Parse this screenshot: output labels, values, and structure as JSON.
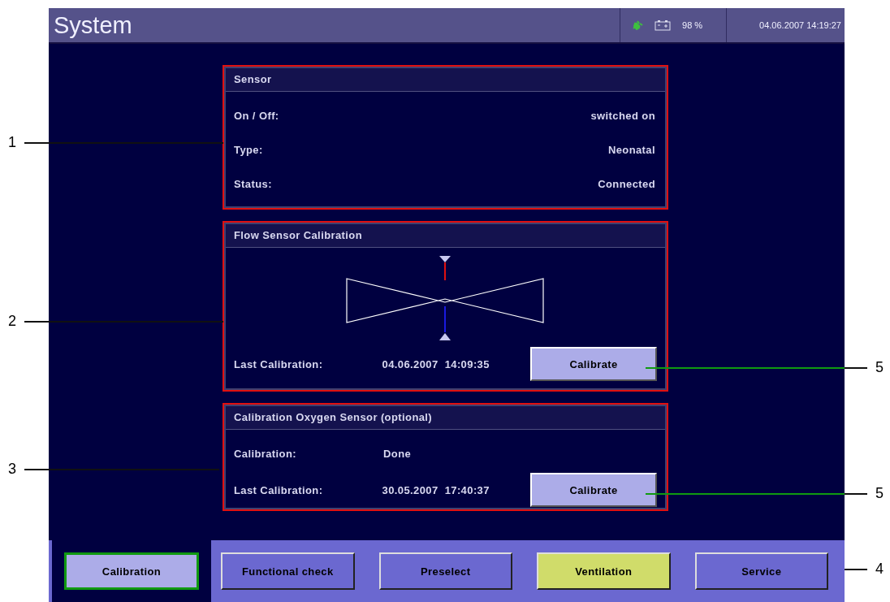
{
  "header": {
    "title": "System",
    "battery": "98 %",
    "datetime": "04.06.2007 14:19:27"
  },
  "sensor": {
    "title": "Sensor",
    "rows": [
      {
        "label": "On / Off:",
        "value": "switched on"
      },
      {
        "label": "Type:",
        "value": "Neonatal"
      },
      {
        "label": "Status:",
        "value": "Connected"
      }
    ]
  },
  "flow_calibration": {
    "title": "Flow Sensor Calibration",
    "label": "Last Calibration:",
    "value": "04.06.2007  14:09:35",
    "button": "Calibrate"
  },
  "oxygen_calibration": {
    "title": "Calibration Oxygen Sensor (optional)",
    "rows": [
      {
        "label": "Calibration:",
        "value": "Done"
      },
      {
        "label": "Last Calibration:",
        "value": "30.05.2007  17:40:37"
      }
    ],
    "button": "Calibrate"
  },
  "nav": [
    {
      "label": "Calibration",
      "selected": true,
      "kind": "tab"
    },
    {
      "label": "Functional check",
      "selected": false,
      "kind": "tab"
    },
    {
      "label": "Preselect",
      "selected": false,
      "kind": "tab"
    },
    {
      "label": "Ventilation",
      "selected": false,
      "kind": "mode"
    },
    {
      "label": "Service",
      "selected": false,
      "kind": "tab"
    }
  ],
  "callouts": [
    {
      "label": "1"
    },
    {
      "label": "2"
    },
    {
      "label": "3"
    },
    {
      "label": "5"
    },
    {
      "label": "5"
    },
    {
      "label": "4"
    }
  ]
}
